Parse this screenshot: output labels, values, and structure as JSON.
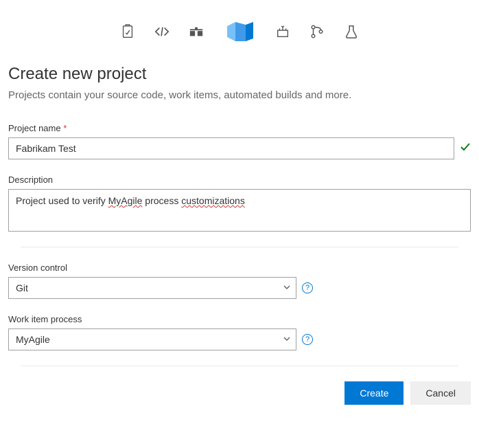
{
  "header": {
    "title": "Create new project",
    "subtitle": "Projects contain your source code, work items, automated builds and more."
  },
  "icons": [
    {
      "name": "dashboard-icon"
    },
    {
      "name": "code-icon"
    },
    {
      "name": "work-items-icon"
    },
    {
      "name": "devops-logo-icon"
    },
    {
      "name": "build-icon"
    },
    {
      "name": "repos-icon"
    },
    {
      "name": "test-plans-icon"
    }
  ],
  "fields": {
    "project_name": {
      "label": "Project name",
      "required_marker": "*",
      "value": "Fabrikam Test",
      "valid": true
    },
    "description": {
      "label": "Description",
      "prefix": "Project used to verify ",
      "spell1": "MyAgile",
      "mid": " process ",
      "spell2": "customizations"
    },
    "version_control": {
      "label": "Version control",
      "value": "Git"
    },
    "work_item_process": {
      "label": "Work item process",
      "value": "MyAgile"
    }
  },
  "buttons": {
    "create": "Create",
    "cancel": "Cancel"
  },
  "help_glyph": "?"
}
